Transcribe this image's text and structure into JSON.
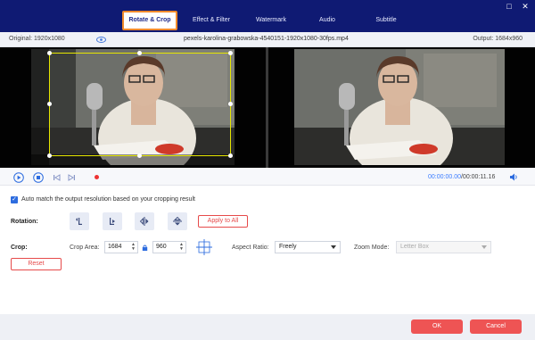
{
  "tabs": [
    {
      "label": "Rotate & Crop",
      "active": true
    },
    {
      "label": "Effect & Filter",
      "active": false
    },
    {
      "label": "Watermark",
      "active": false
    },
    {
      "label": "Audio",
      "active": false
    },
    {
      "label": "Subtitle",
      "active": false
    }
  ],
  "window_buttons": {
    "minimize": "□",
    "close": "✕"
  },
  "info": {
    "original": "Original: 1920x1080",
    "filename": "pexels-karolina-grabowska-4540151-1920x1080-30fps.mp4",
    "output": "Output: 1684x960"
  },
  "playback": {
    "current_time": "00:00:00.00",
    "total_time": "/00:00:11.16",
    "progress_fraction": 0.0
  },
  "auto_match": {
    "checked": true,
    "label": "Auto match the output resolution based on your cropping result"
  },
  "rotation": {
    "label": "Rotation:",
    "apply_label": "Apply to All"
  },
  "crop": {
    "label": "Crop:",
    "area_label": "Crop Area:",
    "width": "1684",
    "height": "960",
    "aspect_label": "Aspect Ratio:",
    "aspect_value": "Freely",
    "zoom_label": "Zoom Mode:",
    "zoom_value": "Letter Box",
    "reset_label": "Reset"
  },
  "footer": {
    "ok_label": "OK",
    "cancel_label": "Cancel"
  },
  "colors": {
    "titlebar": "#0f1a73",
    "accent_red": "#ee5454",
    "tab_highlight": "#f08a2c",
    "crop_border": "#e6e600",
    "time_blue": "#3b7cff"
  }
}
